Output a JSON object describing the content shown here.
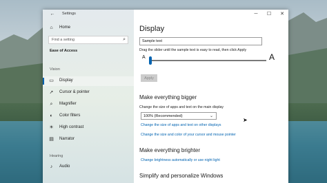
{
  "window": {
    "title": "Settings",
    "back_glyph": "←",
    "minimize_glyph": "─",
    "maximize_glyph": "☐",
    "close_glyph": "✕"
  },
  "sidebar": {
    "home_label": "Home",
    "search_placeholder": "Find a setting",
    "section_title": "Ease of Access",
    "vision_label": "Vision",
    "hearing_label": "Hearing",
    "items": [
      {
        "label": "Display",
        "icon": "display-icon"
      },
      {
        "label": "Cursor & pointer",
        "icon": "cursor-icon"
      },
      {
        "label": "Magnifier",
        "icon": "magnifier-icon"
      },
      {
        "label": "Color filters",
        "icon": "color-filters-icon"
      },
      {
        "label": "High contrast",
        "icon": "high-contrast-icon"
      },
      {
        "label": "Narrator",
        "icon": "narrator-icon"
      },
      {
        "label": "Audio",
        "icon": "audio-icon"
      }
    ]
  },
  "main": {
    "title": "Display",
    "sample_text": "Sample text",
    "slider_instructions": "Drag the slider until the sample text is easy to read, then click Apply",
    "slider_min_label": "A",
    "slider_max_label": "A",
    "slider_value": 0.0,
    "apply_label": "Apply",
    "bigger_heading": "Make everything bigger",
    "bigger_desc": "Change the size of apps and text on the main display",
    "scale_value": "100% (Recommended)",
    "link_other_displays": "Change the size of apps and text on other displays",
    "link_cursor": "Change the size and color of your cursor and mouse pointer",
    "brighter_heading": "Make everything brighter",
    "link_brightness": "Change brightness automatically or use night light",
    "simplify_heading": "Simplify and personalize Windows"
  },
  "colors": {
    "accent": "#0063b1",
    "link": "#0063b1"
  }
}
